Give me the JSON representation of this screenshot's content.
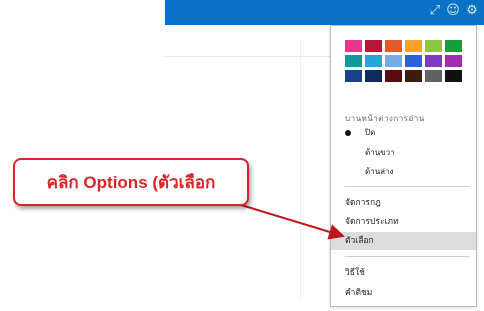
{
  "topbar": {
    "color": "#0a72c6",
    "icons": [
      "link-icon",
      "person-icon",
      "gear-icon"
    ]
  },
  "colors": [
    [
      "#e8378f",
      "#b3173a",
      "#e05c2e",
      "#f9a02d",
      "#8dc640",
      "#159e3a"
    ],
    [
      "#0e9b9b",
      "#27a6d8",
      "#75a9e8",
      "#2f5fd6",
      "#7e3ac4",
      "#a12cb6"
    ],
    [
      "#1b3f8a",
      "#102a5e",
      "#5a0a12",
      "#3b1d10",
      "#616161",
      "#111111"
    ]
  ],
  "reading_pane": {
    "label": "บานหน้าต่างการอ่าน",
    "options": [
      {
        "label": "ปิด",
        "selected": true
      },
      {
        "label": "ด้านขวา",
        "selected": false
      },
      {
        "label": "ด้านล่าง",
        "selected": false
      }
    ]
  },
  "menu": {
    "manage_rules": "จัดการกฎ",
    "manage_categories": "จัดการประเภท",
    "options": "ตัวเลือก",
    "help": "วิธีใช้",
    "feedback": "คำติชม"
  },
  "callout": {
    "text": "คลิก Options (ตัวเลือก"
  }
}
